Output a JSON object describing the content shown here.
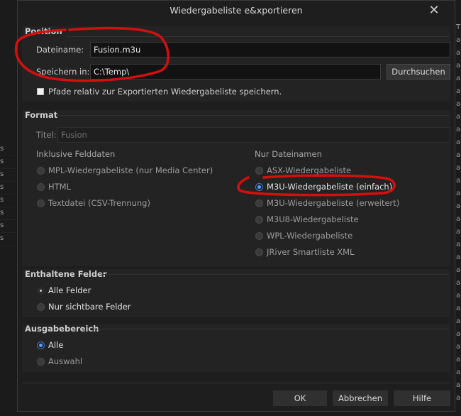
{
  "dialog": {
    "title": "Wiedergabeliste e&xportieren",
    "close_glyph": "✕"
  },
  "position": {
    "header": "Position",
    "filename_label": "Dateiname:",
    "filename_value": "Fusion.m3u",
    "savein_label": "Speichern in:",
    "savein_value": "C:\\Temp\\",
    "browse_label": "Durchsuchen",
    "relative_label": "Pfade relativ zur Exportierten Wiedergabeliste speichern.",
    "relative_checked": false
  },
  "format": {
    "header": "Format",
    "title_label": "Titel:",
    "title_value": "Fusion",
    "left_group_label": "Inklusive Felddaten",
    "left_options": [
      {
        "label": "MPL-Wiedergabeliste (nur Media Center)",
        "selected": false
      },
      {
        "label": "HTML",
        "selected": false
      },
      {
        "label": "Textdatei (CSV-Trennung)",
        "selected": false
      }
    ],
    "right_group_label": "Nur Dateinamen",
    "right_options": [
      {
        "label": "ASX-Wiedergabeliste",
        "selected": false
      },
      {
        "label": "M3U-Wiedergabeliste (einfach)",
        "selected": true
      },
      {
        "label": "M3U-Wiedergabeliste (erweitert)",
        "selected": false
      },
      {
        "label": "M3U8-Wiedergabeliste",
        "selected": false
      },
      {
        "label": "WPL-Wiedergabeliste",
        "selected": false
      },
      {
        "label": "JRiver Smartliste XML",
        "selected": false
      }
    ]
  },
  "fields": {
    "header": "Enthaltene Felder",
    "options": [
      {
        "label": "Alle Felder",
        "selected": true
      },
      {
        "label": "Nur sichtbare Felder",
        "selected": false
      }
    ]
  },
  "range": {
    "header": "Ausgabebereich",
    "options": [
      {
        "label": "Alle",
        "selected": true
      },
      {
        "label": "Auswahl",
        "selected": false
      }
    ]
  },
  "buttons": {
    "ok": "OK",
    "cancel": "Abbrechen",
    "help": "Hilfe"
  },
  "background": {
    "left_glyphs": [
      "s",
      "s",
      "s",
      "s",
      "s",
      "s",
      "s",
      "s"
    ],
    "right_glyphs": [
      "T",
      "a",
      "a",
      "a",
      "a",
      "a",
      "a",
      "a",
      "a",
      "a",
      "a",
      "a",
      "a",
      "a",
      "a",
      "a",
      "a",
      "a",
      "a",
      "a",
      "a",
      "a",
      "a",
      "a",
      "a",
      "a",
      "a",
      "a",
      "a",
      "a"
    ]
  },
  "colors": {
    "annotation": "#d40f0f",
    "accent_radio": "#5aa0ff"
  }
}
